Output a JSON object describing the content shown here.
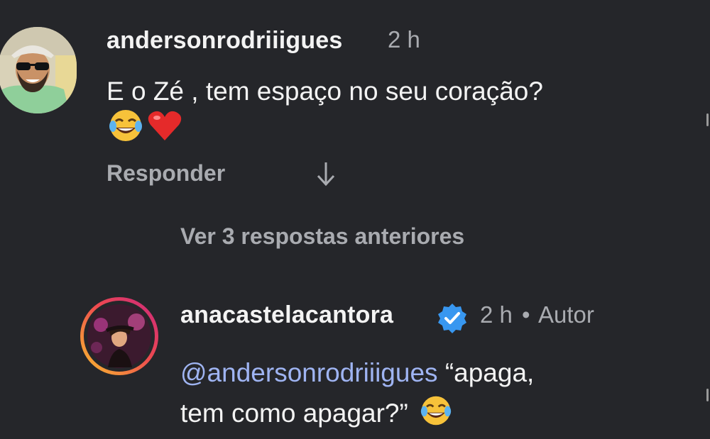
{
  "comment_1": {
    "username": "andersonrodriiigues",
    "time": "2 h",
    "text": "E o Zé , tem espaço no seu coração?",
    "emojis": [
      "tears-of-joy-emoji",
      "red-heart-emoji"
    ],
    "reply_label": "Responder",
    "arrow_icon": "arrow-down-icon"
  },
  "view_replies_label": "Ver 3 respostas anteriores",
  "comment_2": {
    "username": "anacastelacantora",
    "verified": true,
    "time": "2 h",
    "separator": "•",
    "author_label": "Autor",
    "mention": "@andersonrodriiigues",
    "text_part1": " “apaga,",
    "text_part2": "tem como apagar?”",
    "emojis": [
      "tears-of-joy-emoji"
    ]
  },
  "colors": {
    "background": "#25262a",
    "text_primary": "#f3f3f3",
    "text_secondary": "#a9abb0",
    "mention": "#9fb4f2",
    "verified_badge": "#3897f0",
    "story_ring_start": "#f9c12d",
    "story_ring_end": "#d8267f"
  }
}
